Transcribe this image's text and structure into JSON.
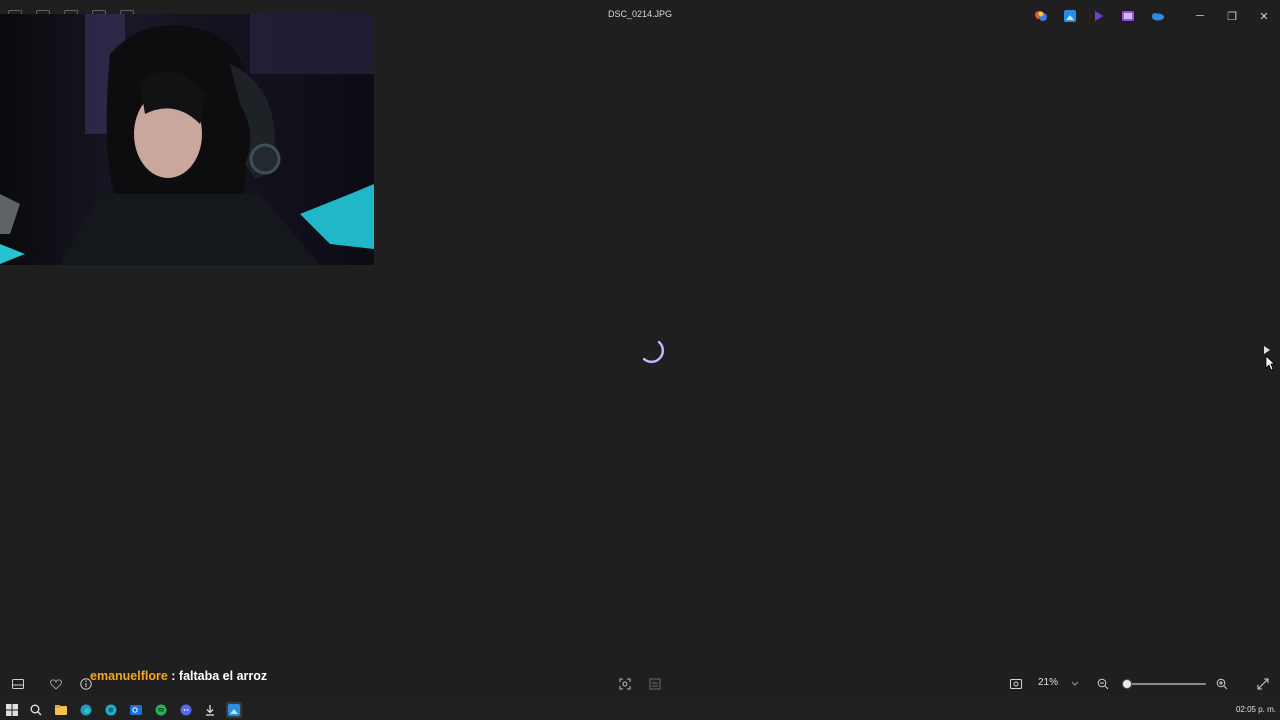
{
  "window": {
    "title": "DSC_0214.JPG"
  },
  "controls": {
    "minimize": "─",
    "restore": "❐",
    "close": "✕"
  },
  "chat": {
    "user": "emanuelflore",
    "separator": " : ",
    "message": "faltaba el arroz"
  },
  "viewer": {
    "zoom": "21%",
    "zoom_level": 0.21,
    "status": "loading"
  },
  "tray_icons": [
    "copilot-icon",
    "photos-icon",
    "clipchamp-icon",
    "video-editor-icon",
    "onedrive-icon"
  ],
  "taskbar": {
    "items": [
      "start-icon",
      "search-icon",
      "file-explorer-icon",
      "edge-icon",
      "edge-dev-icon",
      "outlook-icon",
      "spotify-icon",
      "discord-icon",
      "download-icon",
      "photos-icon"
    ],
    "clock": "02:05 p. m."
  },
  "colors": {
    "background": "#1f1f1f",
    "chat_user": "#f5a623",
    "spinner": "#c9b8ff"
  }
}
